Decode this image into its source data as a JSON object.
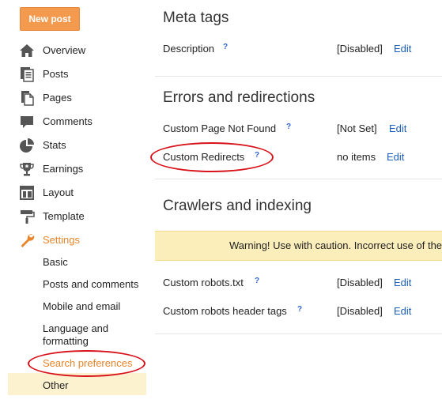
{
  "sidebar": {
    "new_post": "New post",
    "items": [
      {
        "label": "Overview",
        "icon": "home-icon"
      },
      {
        "label": "Posts",
        "icon": "posts-icon"
      },
      {
        "label": "Pages",
        "icon": "pages-icon"
      },
      {
        "label": "Comments",
        "icon": "comment-icon"
      },
      {
        "label": "Stats",
        "icon": "pie-chart-icon"
      },
      {
        "label": "Earnings",
        "icon": "trophy-icon"
      },
      {
        "label": "Layout",
        "icon": "layout-icon"
      },
      {
        "label": "Template",
        "icon": "paint-roller-icon"
      },
      {
        "label": "Settings",
        "icon": "wrench-icon"
      }
    ],
    "settings_sub": [
      "Basic",
      "Posts and comments",
      "Mobile and email",
      "Language and",
      "formatting",
      "Search preferences",
      "Other"
    ]
  },
  "main": {
    "meta_tags": {
      "title": "Meta tags",
      "description": {
        "label": "Description",
        "help": "?",
        "value": "[Disabled]",
        "edit": "Edit"
      }
    },
    "errors": {
      "title": "Errors and redirections",
      "not_found": {
        "label": "Custom Page Not Found",
        "help": "?",
        "value": "[Not Set]",
        "edit": "Edit"
      },
      "redirects": {
        "label": "Custom Redirects",
        "help": "?",
        "value": "no items",
        "edit": "Edit"
      }
    },
    "crawlers": {
      "title": "Crawlers and indexing",
      "warning": "Warning! Use with caution. Incorrect use of the",
      "robots_txt": {
        "label": "Custom robots.txt",
        "help": "?",
        "value": "[Disabled]",
        "edit": "Edit"
      },
      "robots_header": {
        "label": "Custom robots header tags",
        "help": "?",
        "value": "[Disabled]",
        "edit": "Edit"
      }
    }
  },
  "colors": {
    "accent_orange": "#e8852a",
    "link_blue": "#1a5fbd",
    "warning_bg": "#fbeebb",
    "annotation_red": "#d8121a"
  }
}
